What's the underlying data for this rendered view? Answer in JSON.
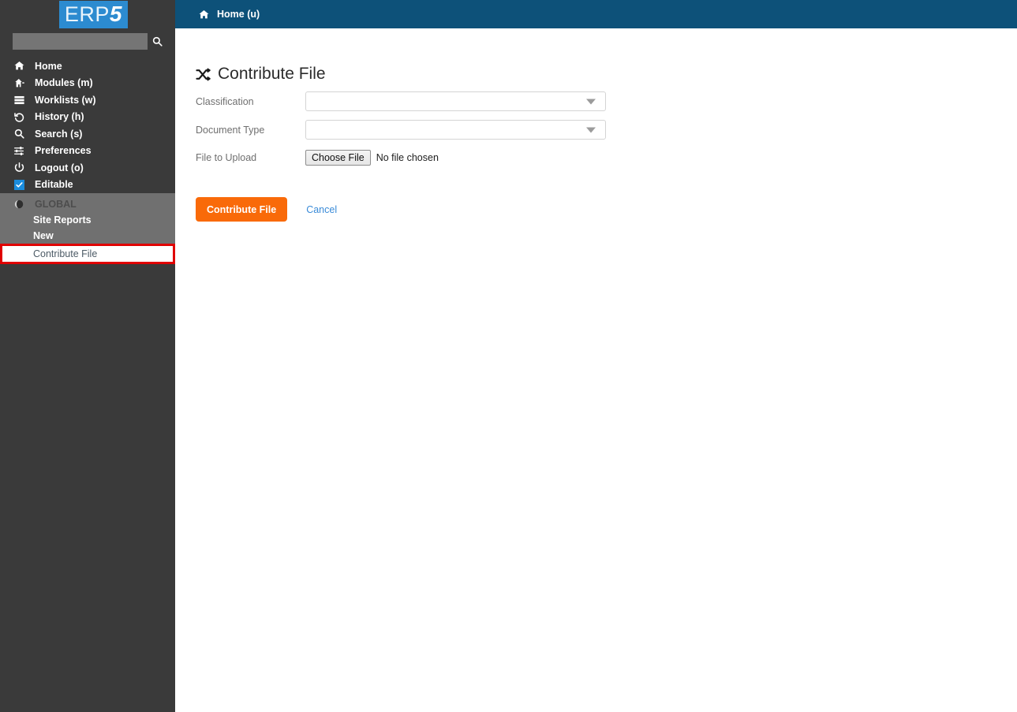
{
  "brand": {
    "logo_prefix": "ERP",
    "logo_suffix": "5",
    "logo_bg": "#2c8bd0"
  },
  "sidebar": {
    "search": {
      "value": "",
      "placeholder": "",
      "icon": "search-icon"
    },
    "items": [
      {
        "label": "Home",
        "icon": "home-icon"
      },
      {
        "label": "Modules (m)",
        "icon": "modules-icon"
      },
      {
        "label": "Worklists (w)",
        "icon": "worklists-icon"
      },
      {
        "label": "History (h)",
        "icon": "history-icon"
      },
      {
        "label": "Search (s)",
        "icon": "search-icon"
      },
      {
        "label": "Preferences",
        "icon": "sliders-icon"
      },
      {
        "label": "Logout (o)",
        "icon": "power-icon"
      },
      {
        "label": "Editable",
        "icon": "checkbox-checked-icon"
      }
    ],
    "global": {
      "title": "GLOBAL",
      "icon": "globe-icon",
      "links": [
        {
          "label": "Site Reports",
          "active": false
        },
        {
          "label": "New",
          "active": false
        },
        {
          "label": "Contribute File",
          "active": true
        }
      ]
    }
  },
  "header": {
    "breadcrumb_icon": "home-icon",
    "breadcrumb_label": "Home (u)",
    "bg": "#0d5179"
  },
  "main": {
    "title": "Contribute File",
    "title_icon": "shuffle-icon",
    "fields": [
      {
        "label": "Classification",
        "type": "select",
        "value": ""
      },
      {
        "label": "Document Type",
        "type": "select",
        "value": ""
      },
      {
        "label": "File to Upload",
        "type": "file",
        "button_label": "Choose File",
        "status": "No file chosen"
      }
    ],
    "submit_label": "Contribute File",
    "cancel_label": "Cancel",
    "accent": "#f96a09",
    "link_color": "#3a8bd8"
  },
  "annotation": {
    "highlight_color": "#e00000",
    "target": "Contribute File"
  }
}
